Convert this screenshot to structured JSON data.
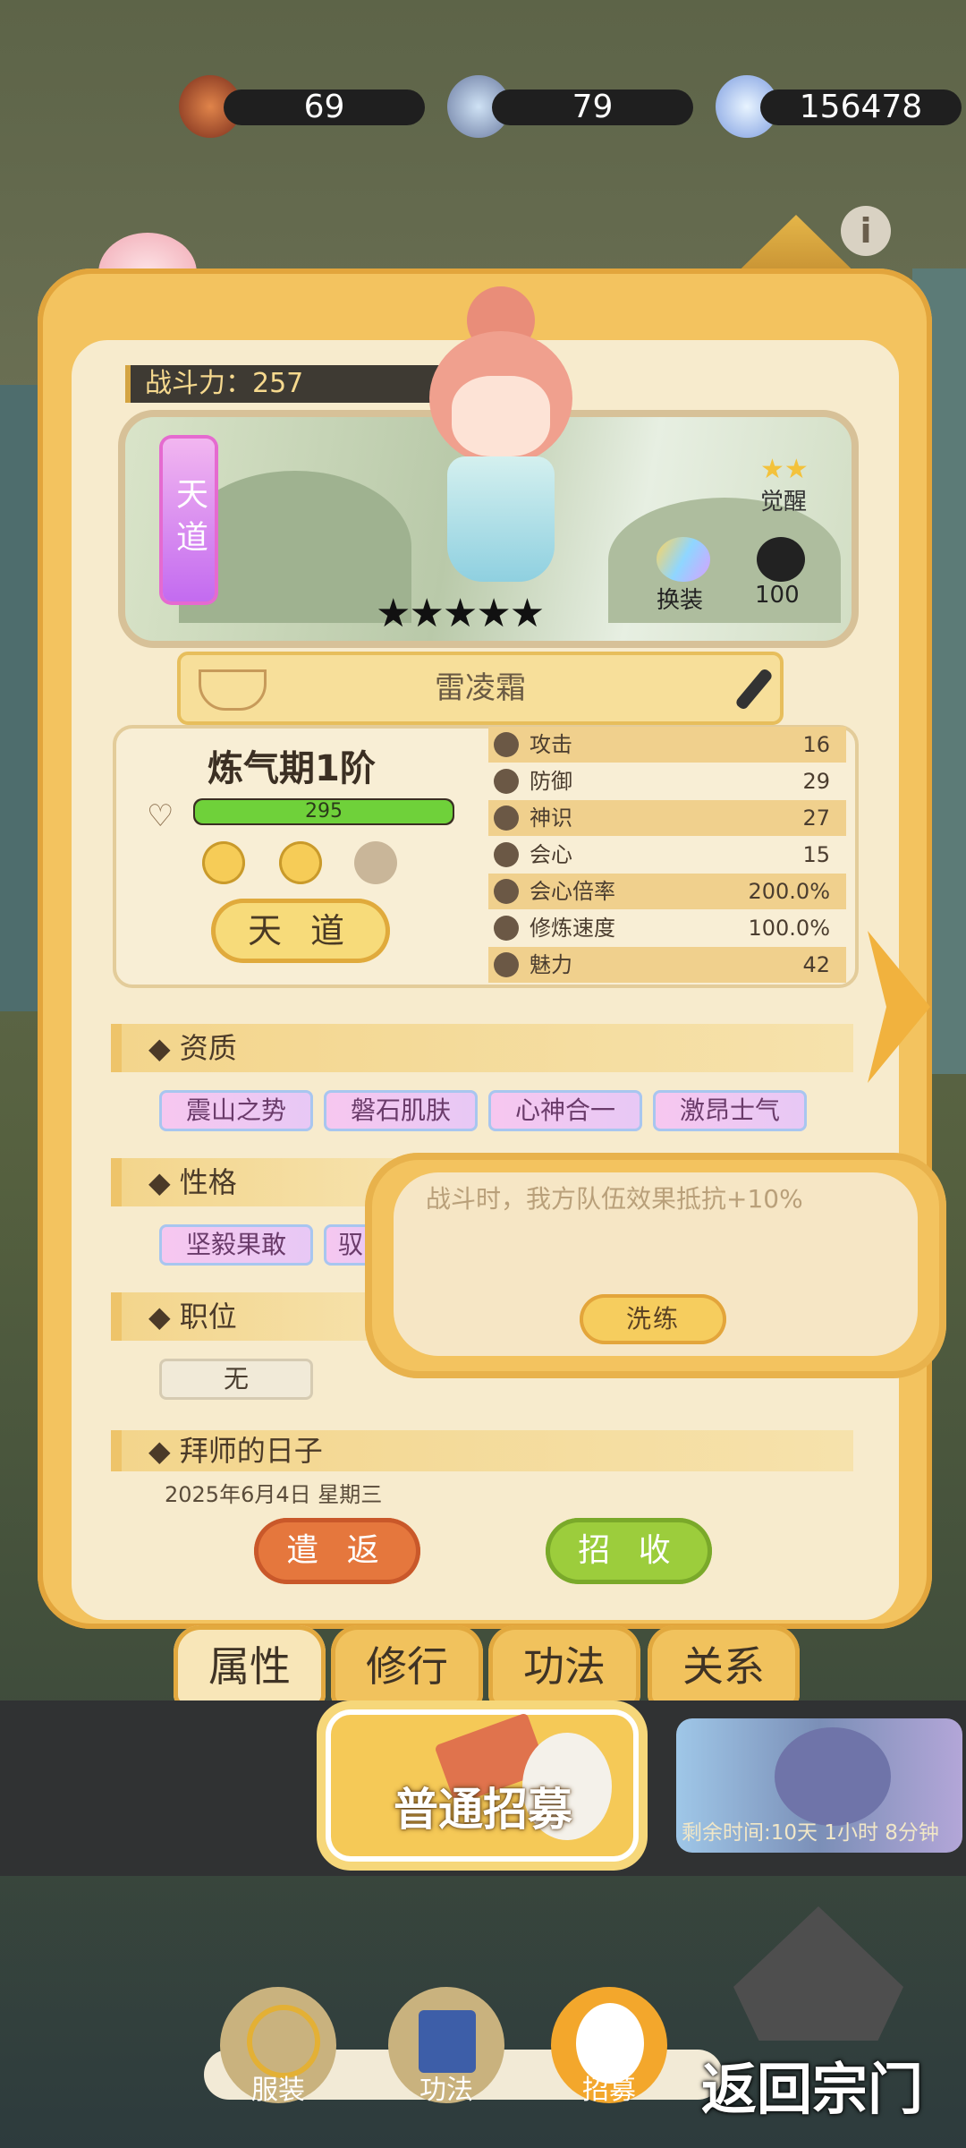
{
  "resources": [
    {
      "name": "red-scroll-icon",
      "value": "69"
    },
    {
      "name": "blue-scroll-icon",
      "value": "79"
    },
    {
      "name": "gem-icon",
      "value": "156478"
    }
  ],
  "character": {
    "power_label": "战斗力：257",
    "tag": "天道",
    "stars": "★★★★★",
    "awaken_label": "觉醒",
    "outfit_label": "换装",
    "follower_count": "100",
    "name": "雷凌霜",
    "realm": "炼气期1阶",
    "hp": "295",
    "hp_fraction": 1.0,
    "path_button": "天 道"
  },
  "stats": [
    {
      "label": "攻击",
      "value": "16"
    },
    {
      "label": "防御",
      "value": "29"
    },
    {
      "label": "神识",
      "value": "27"
    },
    {
      "label": "会心",
      "value": "15"
    },
    {
      "label": "会心倍率",
      "value": "200.0%"
    },
    {
      "label": "修炼速度",
      "value": "100.0%"
    },
    {
      "label": "魅力",
      "value": "42"
    }
  ],
  "sections": {
    "aptitude_title": "◆ 资质",
    "aptitude": [
      "震山之势",
      "磐石肌肤",
      "心神合一",
      "激昂士气"
    ],
    "personality_title": "◆ 性格",
    "personality": [
      "坚毅果敢",
      "驭"
    ],
    "position_title": "◆ 职位",
    "position": "无",
    "date_title": "◆ 拜师的日子",
    "date": "2025年6月4日 星期三"
  },
  "buttons": {
    "dismiss": "遣 返",
    "recruit": "招 收"
  },
  "tabs": [
    "属性",
    "修行",
    "功法",
    "关系"
  ],
  "popup": {
    "text": "战斗时，我方队伍效果抵抗+10%",
    "button": "洗练"
  },
  "recruit_banner": {
    "normal": "普通招募",
    "timer": "剩余时间:10天 1小时 8分钟"
  },
  "bottom_nav": [
    "服装",
    "功法",
    "招募"
  ],
  "return_label": "返回宗门",
  "colors": {
    "panel": "#f3c35f",
    "hp_bar": "#6fd13a",
    "dismiss_btn": "#e5773d",
    "recruit_btn": "#9ccd3c"
  }
}
